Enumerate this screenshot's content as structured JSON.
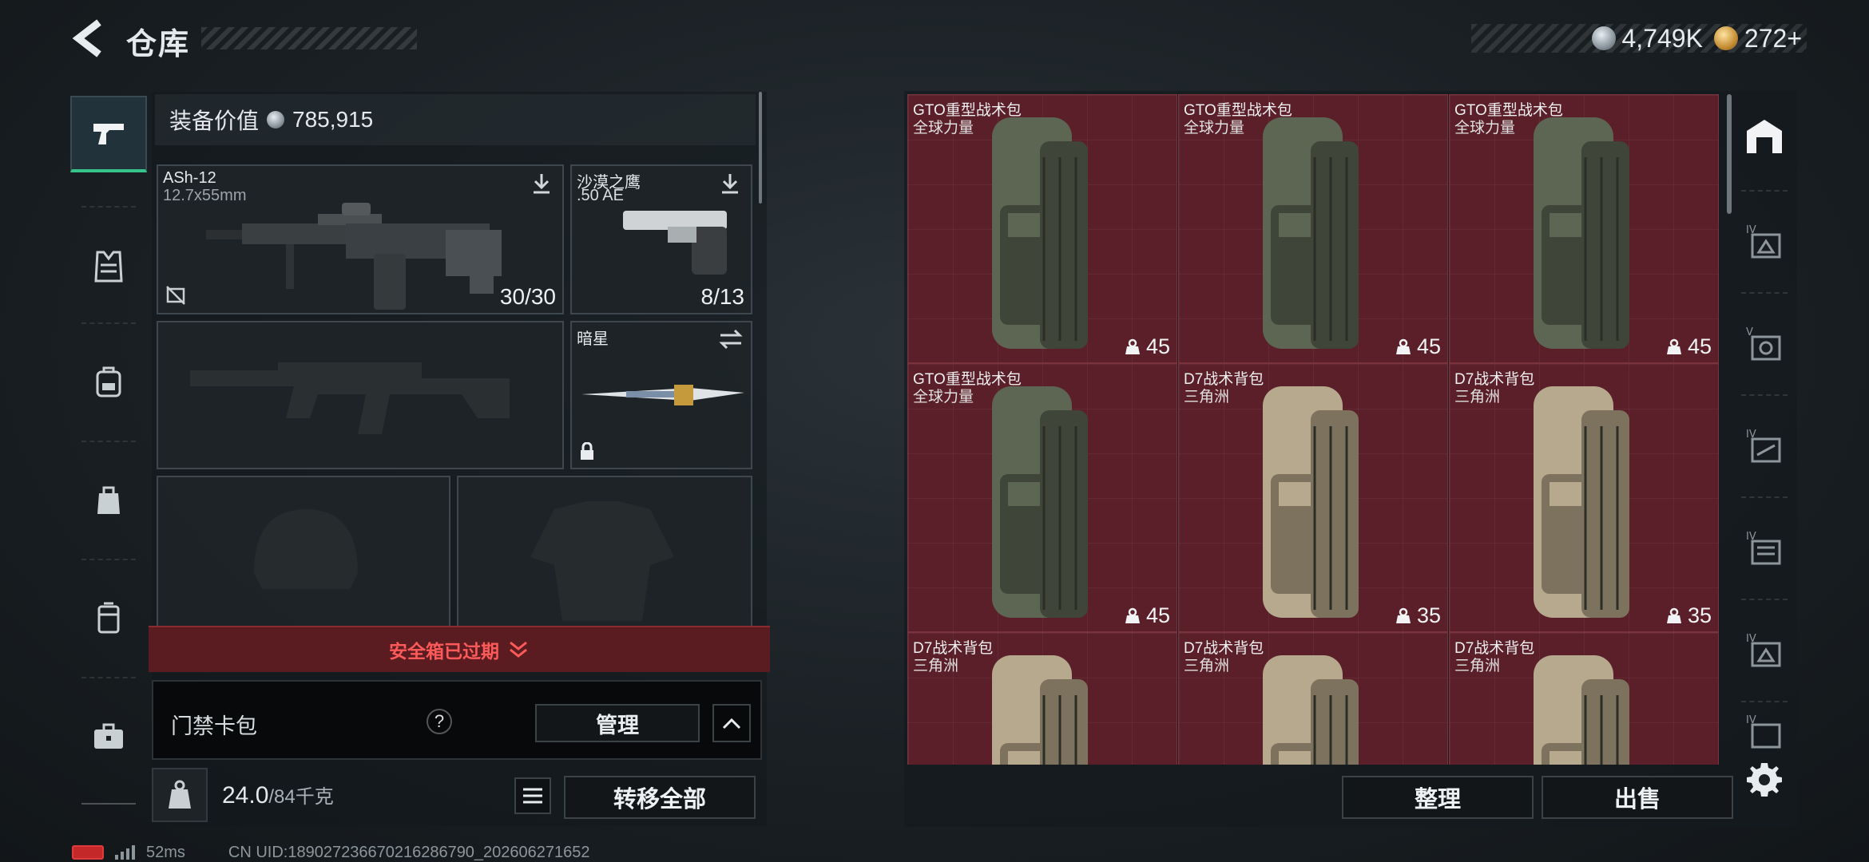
{
  "header": {
    "title": "仓库",
    "currencies": [
      {
        "icon": "silver-coin-icon",
        "value": "4,749K"
      },
      {
        "icon": "gold-coin-icon",
        "value": "272+"
      }
    ]
  },
  "equipment": {
    "value_label": "装备价值",
    "value": "785,915",
    "primary_weapon": {
      "name": "ASh-12",
      "caliber": "12.7x55mm",
      "ammo": "30/30"
    },
    "secondary_weapon": {
      "name": "沙漠之鹰",
      "caliber": ".50 AE",
      "ammo": "8/13"
    },
    "melee": {
      "name": "暗星"
    },
    "safebox_status": "安全箱已过期",
    "keycard": {
      "label": "门禁卡包",
      "manage_label": "管理"
    },
    "weight": {
      "current": "24.0",
      "max": "/84千克"
    },
    "transfer_all_label": "转移全部"
  },
  "inventory": {
    "items": [
      {
        "name": "GTO重型战术包",
        "tag": "全球力量",
        "capacity": "45",
        "color": "olive"
      },
      {
        "name": "GTO重型战术包",
        "tag": "全球力量",
        "capacity": "45",
        "color": "olive"
      },
      {
        "name": "GTO重型战术包",
        "tag": "全球力量",
        "capacity": "45",
        "color": "olive"
      },
      {
        "name": "GTO重型战术包",
        "tag": "全球力量",
        "capacity": "45",
        "color": "olive"
      },
      {
        "name": "D7战术背包",
        "tag": "三角洲",
        "capacity": "35",
        "color": "tan"
      },
      {
        "name": "D7战术背包",
        "tag": "三角洲",
        "capacity": "35",
        "color": "tan"
      },
      {
        "name": "D7战术背包",
        "tag": "三角洲",
        "capacity": "",
        "color": "tan"
      },
      {
        "name": "D7战术背包",
        "tag": "三角洲",
        "capacity": "",
        "color": "tan"
      },
      {
        "name": "D7战术背包",
        "tag": "三角洲",
        "capacity": "",
        "color": "tan"
      }
    ],
    "sort_label": "整理",
    "sell_label": "出售"
  },
  "status_bar": {
    "ping": "52ms",
    "uid": "CN UID:18902723667021628679​0_202606271652"
  },
  "colors": {
    "cell_bg": "#5a1f28",
    "alert_red": "#ff5a5a",
    "active_green": "#35c58a"
  }
}
